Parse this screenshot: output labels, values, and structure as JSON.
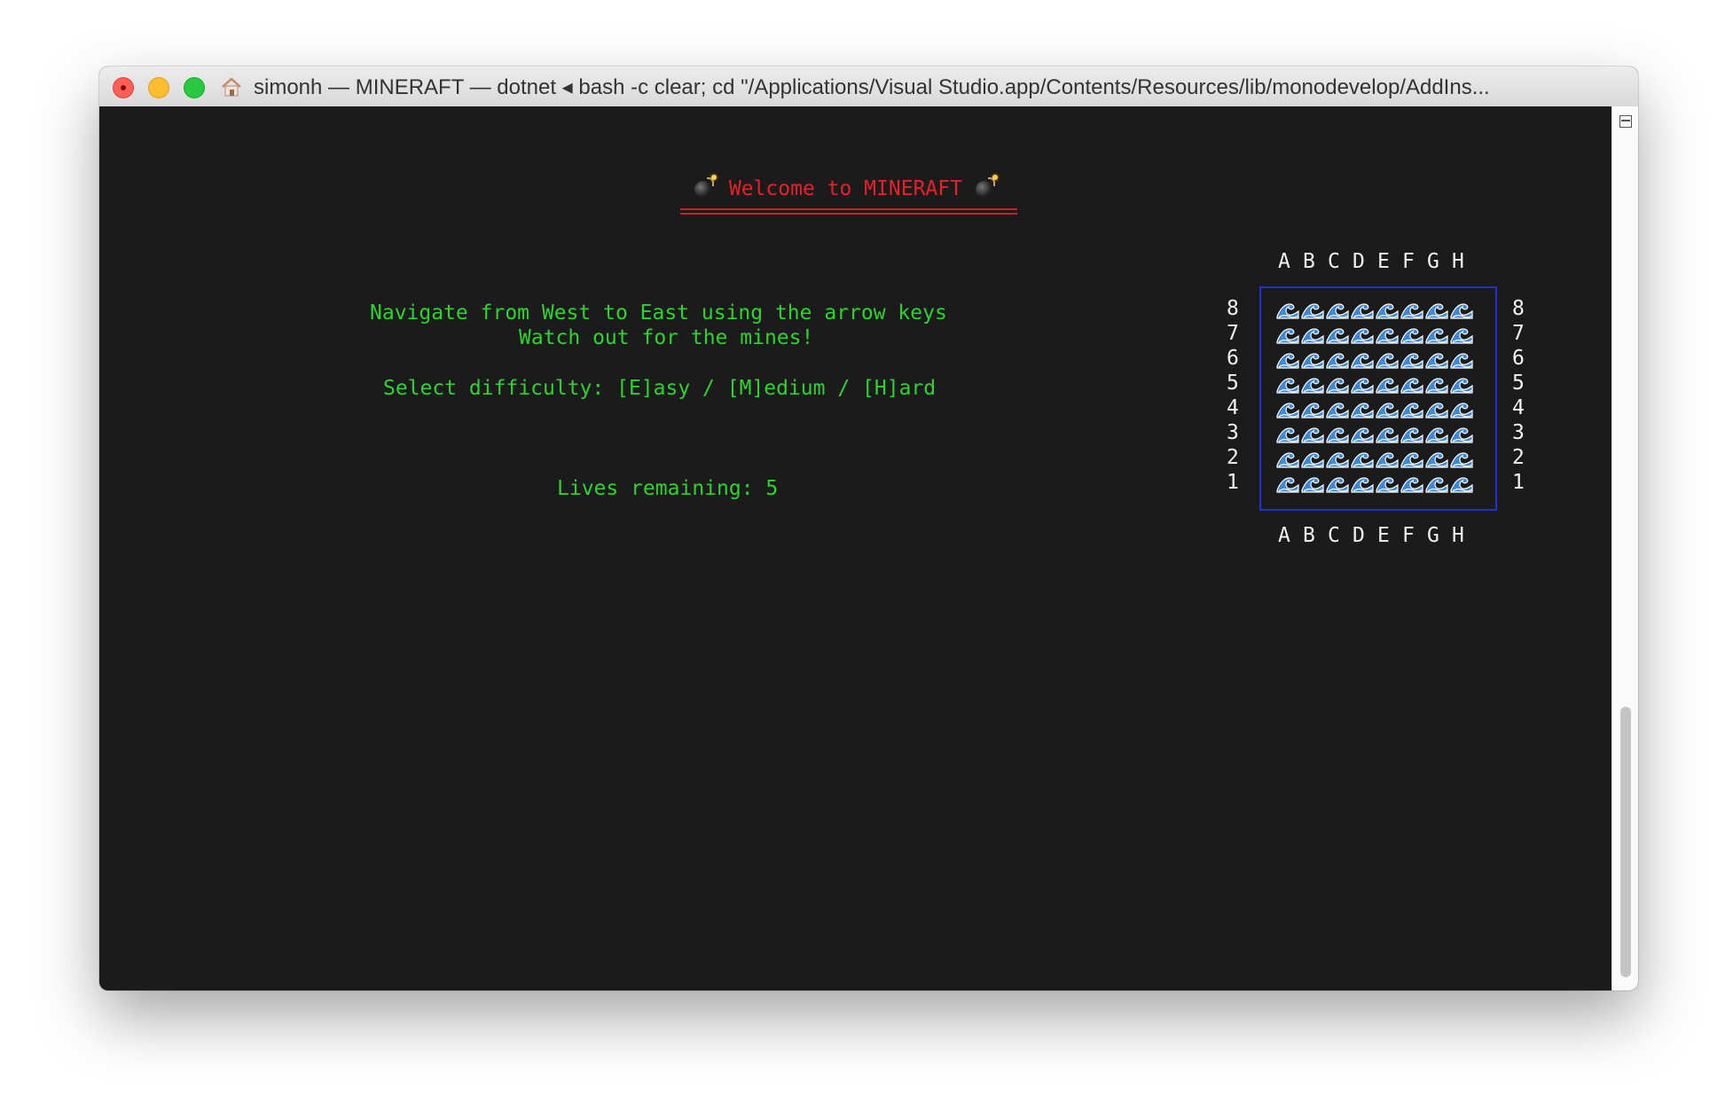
{
  "window": {
    "title": "simonh — MINERAFT — dotnet ◂ bash -c clear; cd \"/Applications/Visual Studio.app/Contents/Resources/lib/monodevelop/AddIns..."
  },
  "game": {
    "welcome": "Welcome to MINERAFT",
    "instruction_line1": "Navigate from West to East using the arrow keys",
    "instruction_line2": "Watch out for the mines!",
    "difficulty": "Select difficulty: [E]asy / [M]edium / [H]ard",
    "lives": "Lives remaining: 5"
  },
  "board": {
    "columns": [
      "A",
      "B",
      "C",
      "D",
      "E",
      "F",
      "G",
      "H"
    ],
    "rows": [
      "8",
      "7",
      "6",
      "5",
      "4",
      "3",
      "2",
      "1"
    ],
    "cell_icon": "wave-icon"
  },
  "colors": {
    "title_red": "#e8202a",
    "text_green": "#2fd32f",
    "board_border": "#2230d8"
  }
}
